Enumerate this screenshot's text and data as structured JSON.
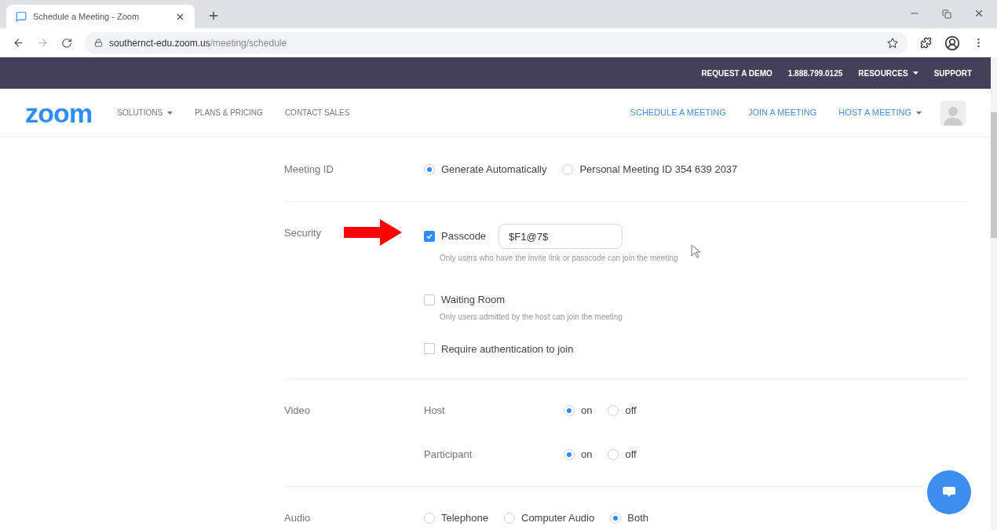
{
  "browser": {
    "tab_title": "Schedule a Meeting - Zoom",
    "url_host": "southernct-edu.zoom.us",
    "url_path": "/meeting/schedule"
  },
  "top_bar": [
    {
      "label": "REQUEST A DEMO",
      "dropdown": false
    },
    {
      "label": "1.888.799.0125",
      "dropdown": false
    },
    {
      "label": "RESOURCES",
      "dropdown": true
    },
    {
      "label": "SUPPORT",
      "dropdown": false
    }
  ],
  "nav": {
    "logo": "zoom",
    "left": [
      {
        "label": "SOLUTIONS",
        "dropdown": true
      },
      {
        "label": "PLANS & PRICING",
        "dropdown": false
      },
      {
        "label": "CONTACT SALES",
        "dropdown": false
      }
    ],
    "right": [
      {
        "label": "SCHEDULE A MEETING",
        "dropdown": false
      },
      {
        "label": "JOIN A MEETING",
        "dropdown": false
      },
      {
        "label": "HOST A MEETING",
        "dropdown": true
      }
    ]
  },
  "sections": [
    {
      "label": "Meeting ID",
      "kind": "radios",
      "options": [
        {
          "label": "Generate Automatically",
          "selected": true
        },
        {
          "label": "Personal Meeting ID 354 639 2037",
          "selected": false
        }
      ]
    },
    {
      "label": "Security",
      "kind": "checks",
      "arrow": true,
      "items": [
        {
          "label": "Passcode",
          "checked": true,
          "value": "$F1@7$",
          "hint": "Only users who have the invite link or passcode can join the meeting"
        },
        {
          "label": "Waiting Room",
          "checked": false,
          "hint": "Only users admitted by the host can join the meeting"
        },
        {
          "label": "Require authentication to join",
          "checked": false
        }
      ]
    },
    {
      "label": "Video",
      "kind": "toggles",
      "rows": [
        {
          "label": "Host",
          "options": [
            {
              "label": "on",
              "selected": true
            },
            {
              "label": "off",
              "selected": false
            }
          ]
        },
        {
          "label": "Participant",
          "options": [
            {
              "label": "on",
              "selected": true
            },
            {
              "label": "off",
              "selected": false
            }
          ]
        }
      ]
    },
    {
      "label": "Audio",
      "kind": "radios",
      "options": [
        {
          "label": "Telephone",
          "selected": false
        },
        {
          "label": "Computer Audio",
          "selected": false
        },
        {
          "label": "Both",
          "selected": true
        }
      ]
    }
  ]
}
